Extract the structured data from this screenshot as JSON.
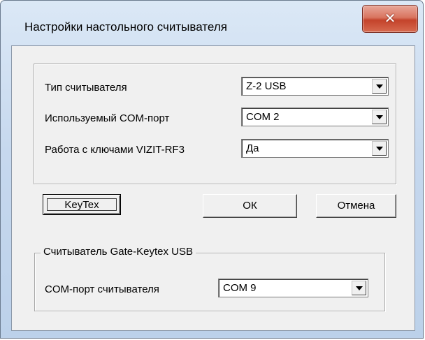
{
  "window": {
    "title": "Настройки настольного считывателя",
    "close_glyph": "✕"
  },
  "reader_settings": {
    "rows": [
      {
        "label": "Тип считывателя",
        "value": "Z-2 USB"
      },
      {
        "label": "Используемый COM-порт",
        "value": "COM 2"
      },
      {
        "label": "Работа с ключами VIZIT-RF3",
        "value": "Да"
      }
    ]
  },
  "buttons": {
    "keytex": "KeyTex",
    "ok": "ОК",
    "cancel": "Отмена"
  },
  "gate_reader": {
    "caption": "Считыватель Gate-Keytex USB",
    "label": "COM-порт считывателя",
    "value": "COM 9"
  },
  "colors": {
    "dialog_bg": "#f0f0f0",
    "close_button": "#c4432b",
    "frame": "#c6d8ee"
  }
}
